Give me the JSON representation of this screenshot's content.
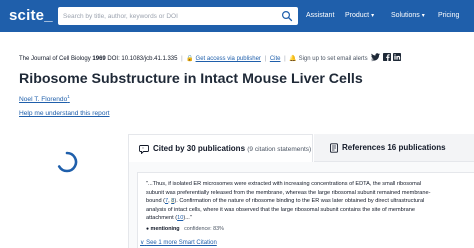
{
  "header": {
    "logo": "scite_",
    "search_placeholder": "Search by title, author, keywords or DOI",
    "nav": [
      {
        "label": "Assistant",
        "has_dropdown": false
      },
      {
        "label": "Product",
        "has_dropdown": true
      },
      {
        "label": "Solutions",
        "has_dropdown": true
      },
      {
        "label": "Pricing",
        "has_dropdown": false
      }
    ]
  },
  "article": {
    "journal": "The Journal of Cell Biology",
    "year": "1969",
    "doi": "DOI: 10.1083/jcb.41.1.335",
    "access_link": "Get access via publisher",
    "cite_link": "Cite",
    "alerts_label": "Sign up to set email alerts",
    "title": "Ribosome Substructure in Intact Mouse Liver Cells",
    "author": "Noel T. Florendo",
    "author_sup": "1",
    "help_link": "Help me understand this report"
  },
  "tabs": {
    "cited_label": "Cited by 30 publications",
    "cited_sub": "(9 citation statements)",
    "refs_label": "References 16 publications"
  },
  "citation": {
    "text_before": "\"...Thus, if isolated ER microsomes were extracted with increasing concentrations of EDTA, the small ribosomal subunit was preferentially released from the membrane, whereas the large ribosomal subunit remained membrane-bound (",
    "ref1": "7",
    "ref1_sep": ", ",
    "ref2": "8",
    "text_middle": "). Confirmation of the nature of ribosome binding to the ER was later obtained by direct ultrastructural analysis of intact cells, where it was observed that the large ribosomal subunit contains the site of membrane attachment (",
    "ref3": "10",
    "text_after": ")...\"",
    "type": "mentioning",
    "confidence": "confidence: 83%",
    "see_more": "See 1 more Smart Citation"
  },
  "colors": {
    "brand": "#1f5fab",
    "highlight": "#fef3c7"
  },
  "icons": [
    "search-icon",
    "lock-icon",
    "bell-icon",
    "twitter-icon",
    "facebook-icon",
    "linkedin-icon",
    "quote-icon",
    "document-icon",
    "spinner-icon",
    "chevron-down-icon"
  ]
}
